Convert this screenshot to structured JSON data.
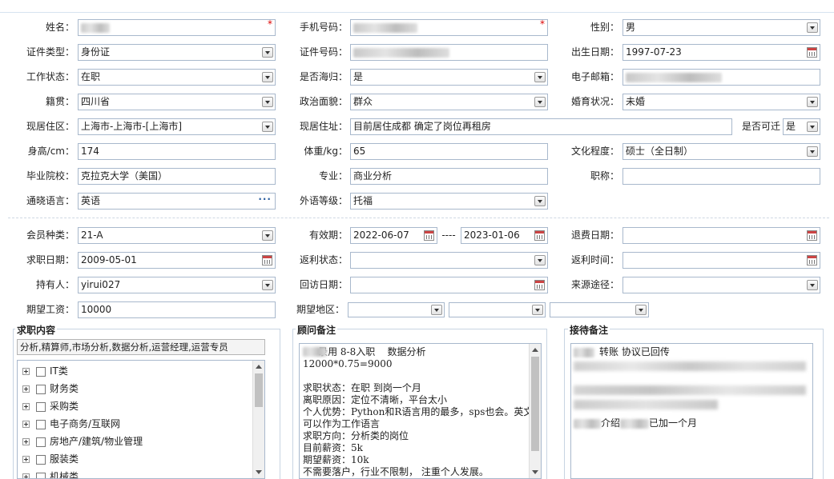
{
  "form": {
    "name": {
      "label": "姓名：",
      "value": "",
      "required": "*"
    },
    "phone": {
      "label": "手机号码：",
      "value": "",
      "required": "*"
    },
    "gender": {
      "label": "性别：",
      "value": "男"
    },
    "id_type": {
      "label": "证件类型：",
      "value": "身份证"
    },
    "id_number": {
      "label": "证件号码：",
      "value": ""
    },
    "birth_date": {
      "label": "出生日期：",
      "value": "1997-07-23"
    },
    "work_status": {
      "label": "工作状态：",
      "value": "在职"
    },
    "overseas": {
      "label": "是否海归：",
      "value": "是"
    },
    "email": {
      "label": "电子邮箱：",
      "value": ""
    },
    "native_place": {
      "label": "籍贯：",
      "value": "四川省"
    },
    "political": {
      "label": "政治面貌：",
      "value": "群众"
    },
    "marital": {
      "label": "婚育状况：",
      "value": "未婚"
    },
    "residence_area": {
      "label": "现居住区：",
      "value": "上海市-上海市-[上海市]"
    },
    "residence_address": {
      "label": "现居住址：",
      "value": "目前居住成都  确定了岗位再租房"
    },
    "relocate": {
      "label": "是否可迁",
      "value": "是"
    },
    "height": {
      "label": "身高/cm：",
      "value": "174"
    },
    "weight": {
      "label": "体重/kg：",
      "value": "65"
    },
    "education": {
      "label": "文化程度：",
      "value": "硕士（全日制）"
    },
    "school": {
      "label": "毕业院校：",
      "value": "克拉克大学（美国）"
    },
    "major": {
      "label": "专业：",
      "value": "商业分析"
    },
    "title": {
      "label": "职称：",
      "value": ""
    },
    "language": {
      "label": "通晓语言：",
      "value": "英语"
    },
    "foreign_level": {
      "label": "外语等级：",
      "value": "托福"
    }
  },
  "membership": {
    "member_type": {
      "label": "会员种类：",
      "value": "21-A"
    },
    "validity": {
      "label": "有效期：",
      "from": "2022-06-07",
      "sep": "----",
      "to": "2023-01-06"
    },
    "refund_date": {
      "label": "退费日期：",
      "value": ""
    },
    "job_date": {
      "label": "求职日期：",
      "value": "2009-05-01"
    },
    "rebate_status": {
      "label": "返利状态：",
      "value": ""
    },
    "rebate_time": {
      "label": "返利时间：",
      "value": ""
    },
    "holder": {
      "label": "持有人：",
      "value": "yirui027"
    },
    "visit_date": {
      "label": "回访日期：",
      "value": ""
    },
    "source": {
      "label": "来源途径：",
      "value": ""
    },
    "expected_salary": {
      "label": "期望工资：",
      "value": "10000"
    },
    "expected_area": {
      "label": "期望地区：",
      "value": ""
    }
  },
  "job_content": {
    "legend": "求职内容",
    "summary": "分析,精算师,市场分析,数据分析,运营经理,运营专员",
    "categories": [
      "IT类",
      "财务类",
      "采购类",
      "电子商务/互联网",
      "房地产/建筑/物业管理",
      "服装类",
      "机械类"
    ]
  },
  "advisor_notes": {
    "legend": "顾问备注",
    "text": "     录用 8-8入职    数据分析\n12000*0.75=9000\n\n求职状态：在职 到岗一个月\n离职原因：定位不清晰，平台太小\n个人优势：Python和R语言用的最多，sps也会。英文\n可以作为工作语言\n求职方向：分析类的岗位\n目前薪资：5k\n期望薪资：10k\n不需要落户，行业不限制， 注重个人发展。"
  },
  "reception_notes": {
    "legend": "接待备注",
    "line1": "转账  协议已回传",
    "line_last_a": "介绍",
    "line_last_b": "已加一个月"
  }
}
